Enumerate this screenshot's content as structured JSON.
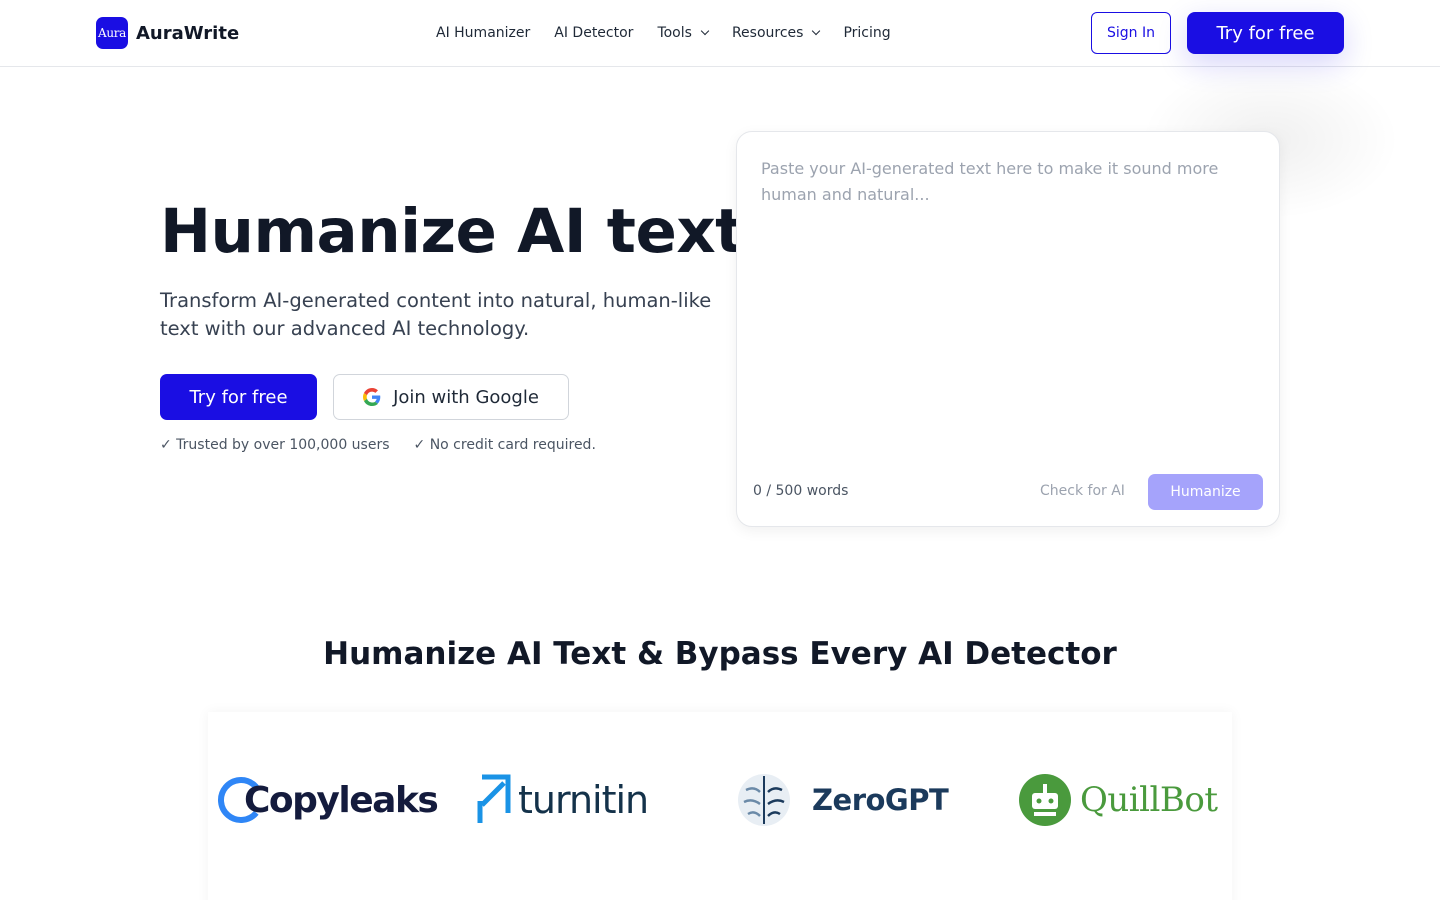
{
  "brand": {
    "logo_mark": "Aura",
    "name": "AuraWrite",
    "accent": "#1a0ee3"
  },
  "nav": {
    "items": [
      {
        "label": "AI Humanizer",
        "dropdown": false
      },
      {
        "label": "AI Detector",
        "dropdown": false
      },
      {
        "label": "Tools",
        "dropdown": true
      },
      {
        "label": "Resources",
        "dropdown": true
      },
      {
        "label": "Pricing",
        "dropdown": false
      }
    ],
    "sign_in": "Sign In",
    "try_free": "Try for free"
  },
  "hero": {
    "title": "Humanize AI text",
    "subtitle": "Transform AI-generated content into natural, human-like text with our advanced AI technology.",
    "try_free": "Try for free",
    "google": "Join with Google",
    "trust": [
      "✓ Trusted by over 100,000 users",
      "✓ No credit card required."
    ]
  },
  "editor": {
    "placeholder": "Paste your AI-generated text here to make it sound more human and natural...",
    "value": "",
    "word_count": "0 / 500 words",
    "check_ai": "Check for AI",
    "humanize": "Humanize"
  },
  "detectors": {
    "title": "Humanize AI Text & Bypass Every AI Detector",
    "logos": [
      {
        "name": "Copyleaks",
        "icon": "copyleaks-logo"
      },
      {
        "name": "turnitin",
        "icon": "turnitin-logo"
      },
      {
        "name": "ZeroGPT",
        "icon": "zerogpt-logo"
      },
      {
        "name": "QuillBot",
        "icon": "quillbot-logo"
      }
    ]
  }
}
